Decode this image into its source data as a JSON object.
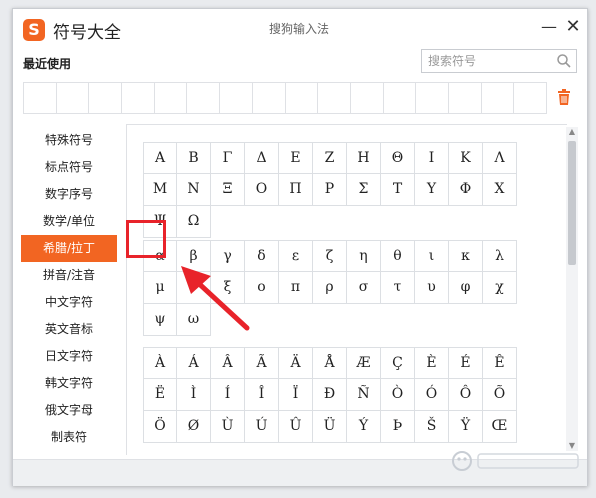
{
  "window": {
    "title": "符号大全",
    "subtitle": "搜狗输入法",
    "logo_text": "S",
    "minimize_glyph": "—",
    "close_glyph": "✕"
  },
  "recent": {
    "label": "最近使用",
    "cells": 16
  },
  "search": {
    "placeholder": "搜索符号",
    "value": ""
  },
  "sidebar": {
    "items": [
      {
        "label": "特殊符号",
        "active": false
      },
      {
        "label": "标点符号",
        "active": false
      },
      {
        "label": "数字序号",
        "active": false
      },
      {
        "label": "数学/单位",
        "active": false
      },
      {
        "label": "希腊/拉丁",
        "active": true
      },
      {
        "label": "拼音/注音",
        "active": false
      },
      {
        "label": "中文字符",
        "active": false
      },
      {
        "label": "英文音标",
        "active": false
      },
      {
        "label": "日文字符",
        "active": false
      },
      {
        "label": "韩文字符",
        "active": false
      },
      {
        "label": "俄文字母",
        "active": false
      },
      {
        "label": "制表符",
        "active": false
      }
    ]
  },
  "groups": [
    {
      "name": "greek-uppercase",
      "symbols": [
        "Α",
        "Β",
        "Γ",
        "Δ",
        "Ε",
        "Ζ",
        "Η",
        "Θ",
        "Ι",
        "Κ",
        "Λ",
        "Μ",
        "Ν",
        "Ξ",
        "Ο",
        "Π",
        "Ρ",
        "Σ",
        "Τ",
        "Υ",
        "Φ",
        "Χ",
        "Ψ",
        "Ω"
      ]
    },
    {
      "name": "greek-lowercase",
      "symbols": [
        "α",
        "β",
        "γ",
        "δ",
        "ε",
        "ζ",
        "η",
        "θ",
        "ι",
        "κ",
        "λ",
        "μ",
        "ν",
        "ξ",
        "ο",
        "π",
        "ρ",
        "σ",
        "τ",
        "υ",
        "φ",
        "χ",
        "ψ",
        "ω"
      ]
    },
    {
      "name": "latin-accented",
      "symbols": [
        "À",
        "Á",
        "Â",
        "Ã",
        "Ä",
        "Å",
        "Æ",
        "Ç",
        "È",
        "É",
        "Ê",
        "Ë",
        "Ì",
        "Í",
        "Î",
        "Ï",
        "Ð",
        "Ñ",
        "Ò",
        "Ó",
        "Ô",
        "Õ",
        "Ö",
        "Ø",
        "Ù",
        "Ú",
        "Û",
        "Ü",
        "Ý",
        "Þ",
        "Š",
        "Ÿ",
        "Œ"
      ]
    }
  ],
  "highlighted_symbol": "α",
  "colors": {
    "accent": "#f26522",
    "annotation": "#e8232a"
  }
}
